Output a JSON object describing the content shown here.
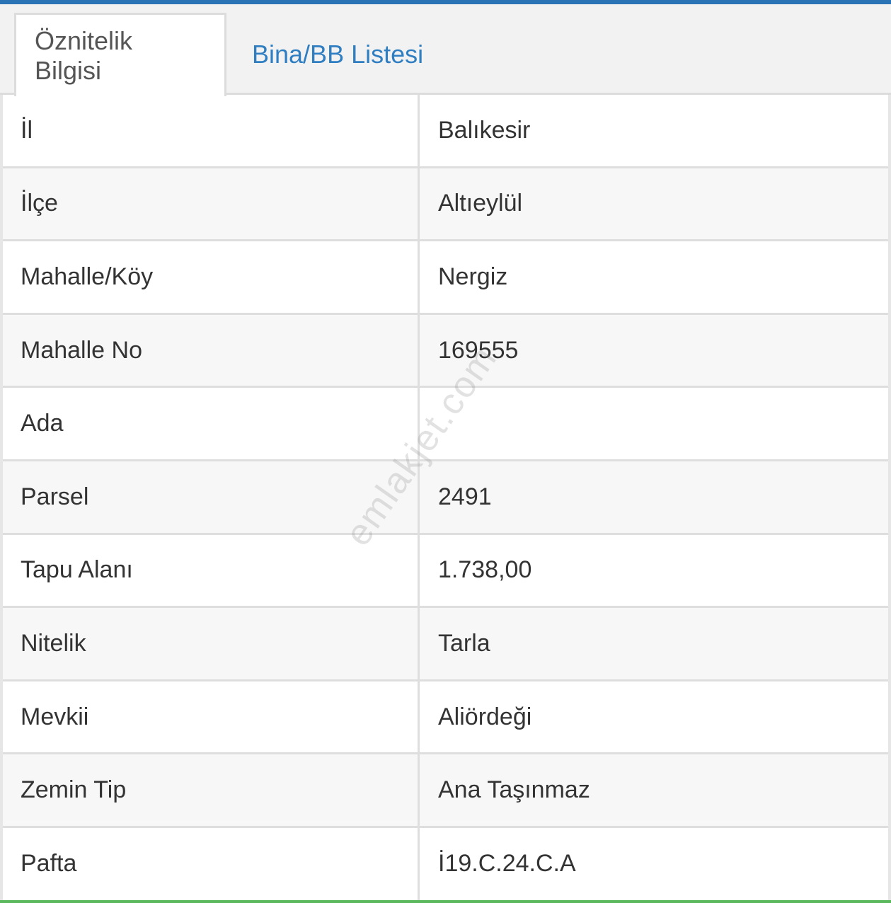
{
  "tabs": [
    {
      "label": "Öznitelik Bilgisi",
      "active": true
    },
    {
      "label": "Bina/BB Listesi",
      "active": false
    }
  ],
  "rows": [
    {
      "label": "İl",
      "value": "Balıkesir"
    },
    {
      "label": "İlçe",
      "value": "Altıeylül"
    },
    {
      "label": "Mahalle/Köy",
      "value": "Nergiz"
    },
    {
      "label": "Mahalle No",
      "value": "169555"
    },
    {
      "label": "Ada",
      "value": ""
    },
    {
      "label": "Parsel",
      "value": "2491"
    },
    {
      "label": "Tapu Alanı",
      "value": "1.738,00"
    },
    {
      "label": "Nitelik",
      "value": "Tarla"
    },
    {
      "label": "Mevkii",
      "value": "Aliördeği"
    },
    {
      "label": "Zemin Tip",
      "value": "Ana Taşınmaz"
    },
    {
      "label": "Pafta",
      "value": "İ19.C.24.C.A"
    }
  ],
  "watermark": "emlakjet.com",
  "colors": {
    "accent": "#2a74b6",
    "link": "#2f7ec1",
    "bottom_accent": "#5cb85c"
  }
}
